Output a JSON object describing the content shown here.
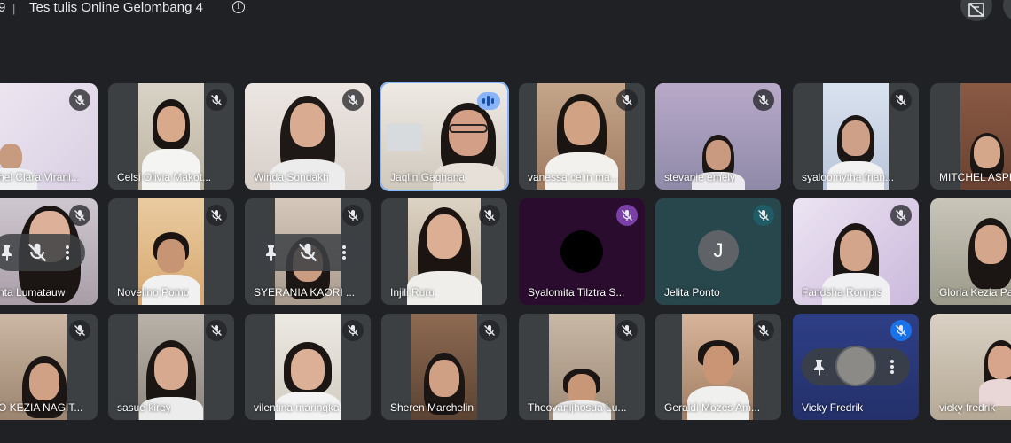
{
  "header": {
    "clock_tail": "9",
    "separator": "|",
    "title": "Tes tulis Online Gelombang 4",
    "info_icon": "i"
  },
  "icons": {
    "info": "info-icon",
    "muted": "mic-off-icon",
    "speaking": "audio-wave-icon",
    "pin": "pin-icon",
    "more": "more-vert-icon",
    "layout": "layout-icon"
  },
  "colors": {
    "background": "#202124",
    "tile": "#3c4043",
    "active_outline": "#8ab4f8",
    "mute_blue": "#1a73e8",
    "mute_purple": "#7b3fa8",
    "mute_teal": "#1f5c66"
  },
  "participants": [
    {
      "name": "hel Clara Virani..."
    },
    {
      "name": "Celsi Olivia Makot..."
    },
    {
      "name": "Winda Sondakh"
    },
    {
      "name": "Jaqlin Gaghana",
      "speaking": true
    },
    {
      "name": "vanessa celin ma..."
    },
    {
      "name": "stevanie emely"
    },
    {
      "name": "syaloomytha frian..."
    },
    {
      "name": "MITCHEL ASPR"
    },
    {
      "name": "nta Lumatauw"
    },
    {
      "name": "Novelino Pomo"
    },
    {
      "name": "SYERANIA KAORI ..."
    },
    {
      "name": "Injili Ruru"
    },
    {
      "name": "Syalomita Tilztra S...",
      "camera_off": true
    },
    {
      "name": "Jelita Ponto",
      "camera_off": true,
      "initial": "J"
    },
    {
      "name": "Fandsha Rompis"
    },
    {
      "name": "Gloria Kezia Pa"
    },
    {
      "name": "O KEZIA NAGIT..."
    },
    {
      "name": "sasue kirey"
    },
    {
      "name": "vilentina maringka"
    },
    {
      "name": "Sheren Marchelin"
    },
    {
      "name": "Theovanijhosua Lu..."
    },
    {
      "name": "Geraldi Mozes Am..."
    },
    {
      "name": "Vicky Fredrik"
    },
    {
      "name": "vicky fredrik"
    }
  ]
}
